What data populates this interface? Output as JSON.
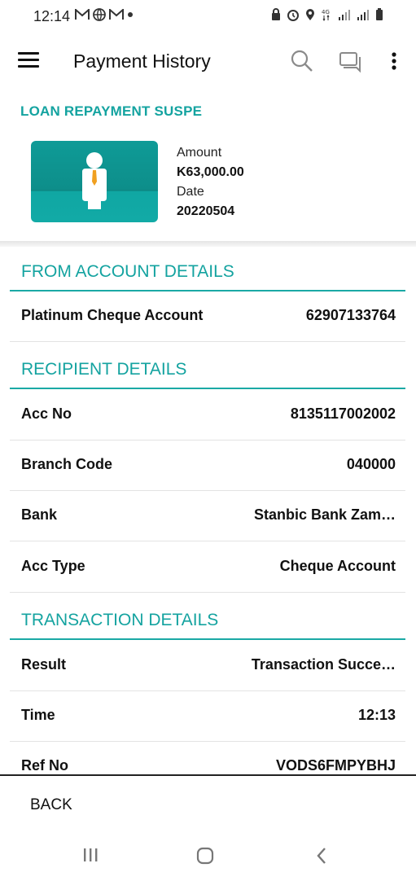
{
  "status_bar": {
    "time": "12:14"
  },
  "app_bar": {
    "title": "Payment History"
  },
  "summary": {
    "title": "LOAN REPAYMENT SUSPE",
    "amount_label": "Amount",
    "amount_value": "K63,000.00",
    "date_label": "Date",
    "date_value": "20220504"
  },
  "from_account": {
    "header": "FROM ACCOUNT DETAILS",
    "rows": [
      {
        "label": "Platinum Cheque Account",
        "value": "62907133764"
      }
    ]
  },
  "recipient": {
    "header": "RECIPIENT DETAILS",
    "rows": [
      {
        "label": "Acc No",
        "value": "8135117002002"
      },
      {
        "label": "Branch Code",
        "value": "040000"
      },
      {
        "label": "Bank",
        "value": "Stanbic Bank Zam…"
      },
      {
        "label": "Acc Type",
        "value": "Cheque Account"
      }
    ]
  },
  "transaction": {
    "header": "TRANSACTION DETAILS",
    "rows": [
      {
        "label": "Result",
        "value": "Transaction Succe…"
      },
      {
        "label": "Time",
        "value": "12:13"
      },
      {
        "label": "Ref No",
        "value": "VODS6FMPYBHJ"
      }
    ]
  },
  "footer": {
    "back_label": "BACK"
  },
  "colors": {
    "accent": "#14a3a0",
    "text": "#111111"
  }
}
